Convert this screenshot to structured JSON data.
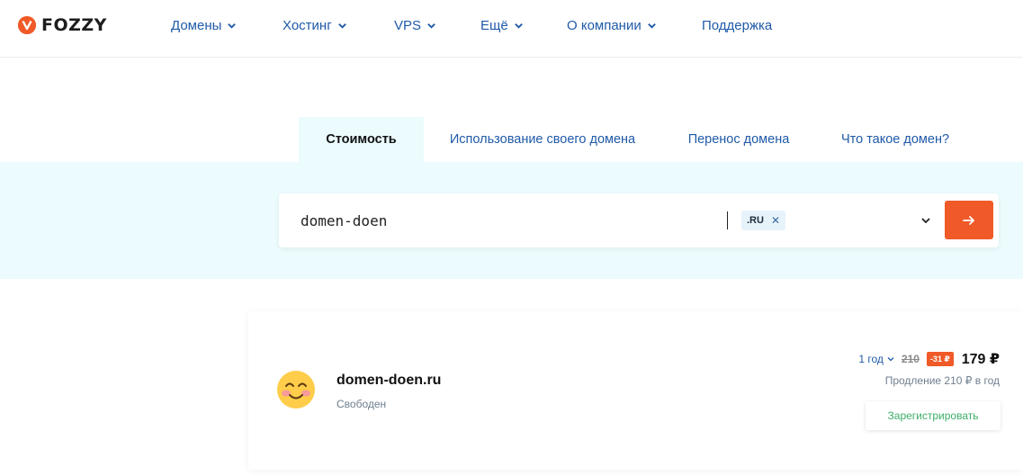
{
  "brand": {
    "name": "FOZZY",
    "accent": "#f05a28"
  },
  "nav": {
    "items": [
      {
        "label": "Домены",
        "dropdown": true
      },
      {
        "label": "Хостинг",
        "dropdown": true
      },
      {
        "label": "VPS",
        "dropdown": true
      },
      {
        "label": "Ещё",
        "dropdown": true
      },
      {
        "label": "О компании",
        "dropdown": true
      },
      {
        "label": "Поддержка",
        "dropdown": false
      }
    ]
  },
  "tabs": [
    {
      "label": "Стоимость",
      "active": true
    },
    {
      "label": "Использование своего домена",
      "active": false
    },
    {
      "label": "Перенос домена",
      "active": false
    },
    {
      "label": "Что такое домен?",
      "active": false
    }
  ],
  "search": {
    "value": "domen-doen",
    "zone": ".RU",
    "remove_icon": "close-icon",
    "submit_icon": "arrow-right-icon"
  },
  "result": {
    "emoji": "smiling-face-icon",
    "domain": "domen-doen.ru",
    "status": "Свободен",
    "period": "1 год",
    "old_price": "210",
    "discount": "-31 ₽",
    "price": "179 ₽",
    "renewal": "Продление 210 ₽ в год",
    "register_label": "Зарегистрировать"
  }
}
